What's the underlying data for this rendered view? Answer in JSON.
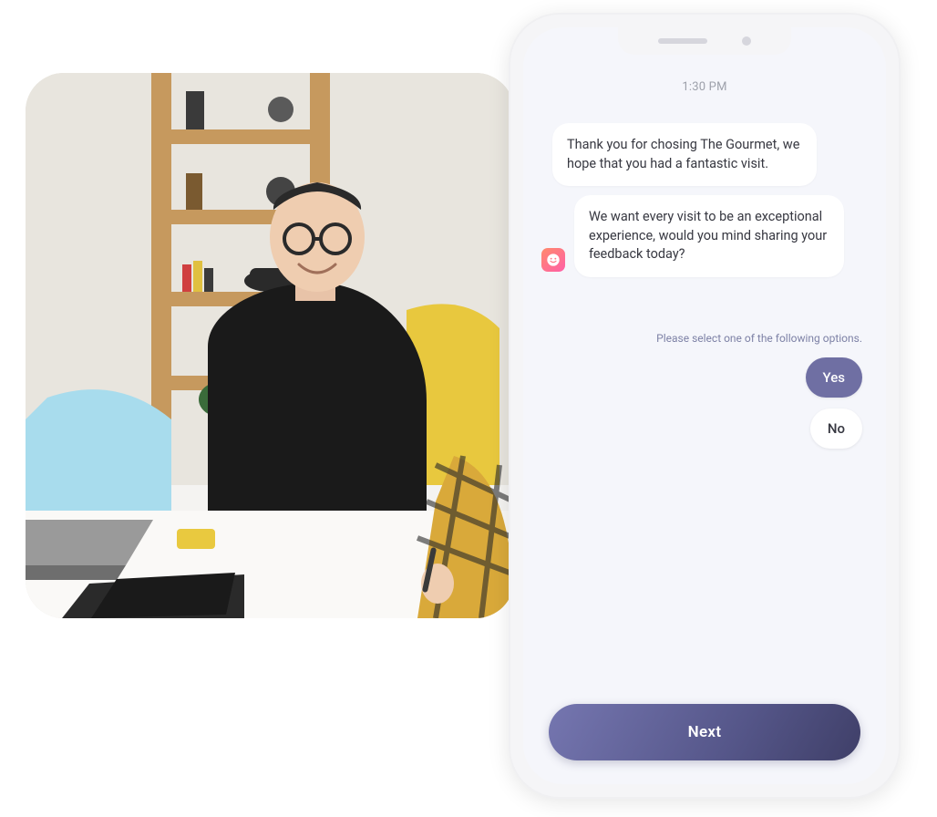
{
  "statusbar": {
    "time": "1:30 PM"
  },
  "messages": {
    "m1": "Thank you for chosing The Gourmet, we hope that you had a fantastic visit.",
    "m2": "We want every visit to be an exceptional experience, would you mind sharing your feedback today?"
  },
  "prompt": {
    "instruction": "Please select one of the following options.",
    "options": {
      "yes": "Yes",
      "no": "No"
    },
    "selected": "yes"
  },
  "cta": {
    "next": "Next"
  },
  "icons": {
    "avatar": "smile-icon"
  },
  "colors": {
    "accent": "#6f6fa3",
    "cta_gradient_from": "#7576b0",
    "cta_gradient_to": "#3f3f68"
  }
}
